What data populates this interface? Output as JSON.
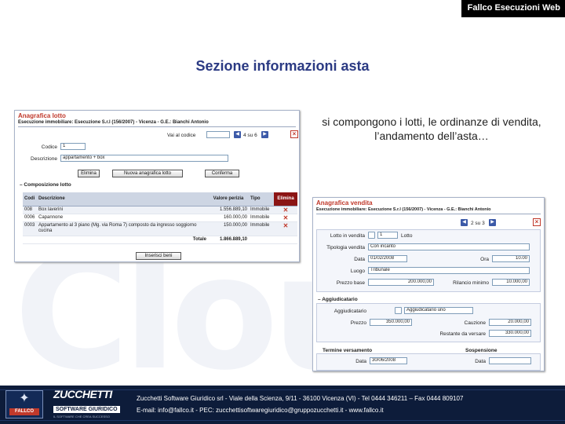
{
  "brand": "Fallco Esecuzioni Web",
  "watermark": "Cloud",
  "title": "Sezione informazioni asta",
  "description": "si compongono i lotti, le ordinanze di vendita, l’andamento dell’asta…",
  "win1": {
    "title": "Anagrafica lotto",
    "subtitle": "Esecuzione immobiliare: Esecuzione S.r.l (156/2007) - Vicenza - G.E.: Bianchi Antonio",
    "goto_label": "Vai al codice",
    "pager": "4 su 6",
    "codice_label": "Codice",
    "codice_value": "1",
    "descrizione_label": "Descrizione",
    "descrizione_value": "appartamento + box",
    "btn_elimina": "Elimina",
    "btn_nuova": "Nuova anagrafica lotto",
    "btn_conferma": "Conferma",
    "section": "Composizione lotto",
    "table": {
      "headers": [
        "Codi",
        "Descrizione",
        "Valore perizia",
        "Tipo",
        "Elimina"
      ],
      "rows": [
        {
          "code": "008",
          "desc": "Box laverini",
          "value": "1.556.889,10",
          "type": "Immobile"
        },
        {
          "code": "0006",
          "desc": "Capannone",
          "value": "160.000,00",
          "type": "Immobile"
        },
        {
          "code": "0003",
          "desc": "Appartamento al 3 piano (Mg. via Roma 7) composto da ingresso soggiorno cucina",
          "value": "150.000,00",
          "type": "Immobile"
        }
      ],
      "total_label": "Totale",
      "total_value": "1.866.889,10"
    },
    "btn_inserisci": "Inserisci beni"
  },
  "win2": {
    "title": "Anagrafica vendita",
    "subtitle": "Esecuzione immobiliare: Esecuzione S.r.l (156/2007) - Vicenza - G.E.: Bianchi Antonio",
    "pager": "2 su 3",
    "lotto_label": "Lotto",
    "lotto_value": "1",
    "tipologia_label": "Tipologia vendita",
    "tipologia_value": "Con incanto",
    "data_label": "Data",
    "data_value": "01/02/2008",
    "ora_label": "Ora",
    "ora_value": "10.00",
    "luogo_label": "Luogo",
    "luogo_value": "Tribunale",
    "prezzo_label": "Prezzo base",
    "prezzo_value": "200.000,00",
    "rilancio_label": "Rilancio minimo",
    "rilancio_value": "10.000,00",
    "aggiudicatario_section": "Aggiudicatario",
    "aggiudicatario_label": "Aggiudicatario",
    "aggiudicatario_value": "Aggiudicatario uno",
    "prezzo2_label": "Prezzo",
    "prezzo2_value": "350.000,00",
    "cauzione_label": "Cauzione",
    "cauzione_value": "20.000,00",
    "residuo_label": "Restante da versare",
    "residuo_value": "330.000,00",
    "termine_section": "Termine versamento",
    "sospensione_section": "Sospensione",
    "termine_value": "30/06/2008",
    "sosp_data_label": "Data"
  },
  "footer": {
    "logo": "FALLCO",
    "zucchetti": "ZUCCHETTI",
    "software": "SOFTWARE GIURIDICO",
    "tagline": "IL SOFTWARE CHE CREA SUCCESSO",
    "line1": "Zucchetti Software Giuridico srl - Viale della Scienza, 9/11 - 36100 Vicenza (VI) - Tel 0444 346211 – Fax 0444 809107",
    "line2": "E-mail: info@fallco.it - PEC: zucchettisoftwaregiuridico@gruppozucchetti.it - www.fallco.it"
  }
}
